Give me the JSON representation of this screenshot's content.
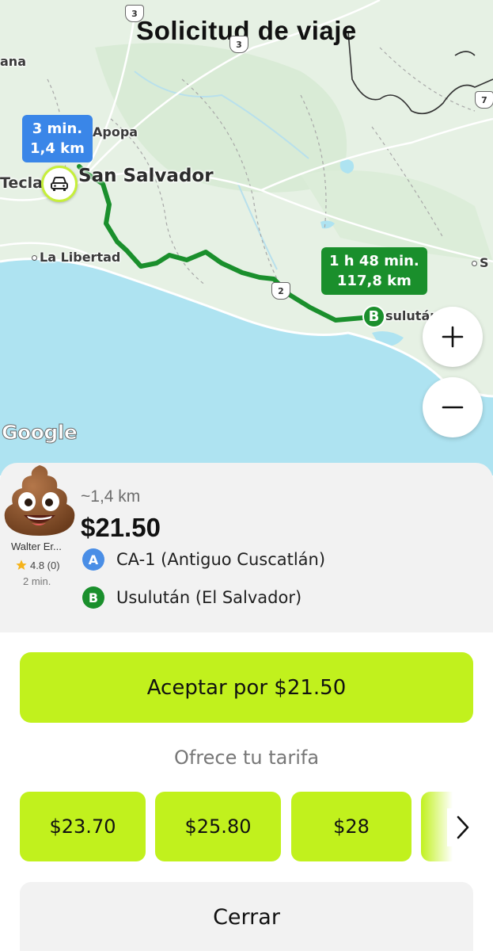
{
  "header": {
    "title": "Solicitud de viaje"
  },
  "map": {
    "places": {
      "ana": "ana",
      "apopa": "Apopa",
      "tecla": "Tecla",
      "san_salvador": "San Salvador",
      "la_libertad": "La Libertad",
      "usulutan_map": "sulután",
      "s_edge": "S"
    },
    "route_shields": {
      "r3a": "3",
      "r3b": "3",
      "r2": "2",
      "r7": "7"
    },
    "pickup_bubble": {
      "time": "3 min.",
      "distance": "1,4 km"
    },
    "dest_bubble": {
      "time": "1 h 48 min.",
      "distance": "117,8 km"
    },
    "dest_marker": "B",
    "attribution": "Google",
    "colors": {
      "route": "#1a8f2c",
      "pickup_bubble": "#3a86e8",
      "dest_bubble": "#1a8f2c",
      "water": "#aee3f1"
    }
  },
  "driver": {
    "name": "Walter Er...",
    "rating": "4.8 (0)",
    "eta": "2 min.",
    "avatar": "poop-emoji-icon"
  },
  "trip": {
    "distance": "~1,4 km",
    "price": "$21.50",
    "pickup": {
      "label": "A",
      "address": "CA-1 (Antiguo Cuscatlán)"
    },
    "dropoff": {
      "label": "B",
      "address": "Usulután (El Salvador)"
    }
  },
  "actions": {
    "accept_label": "Aceptar por $21.50",
    "offer_label": "Ofrece tu tarifa",
    "fares": [
      "$23.70",
      "$25.80",
      "$28"
    ],
    "close_label": "Cerrar",
    "accent": "#c1f11d"
  }
}
